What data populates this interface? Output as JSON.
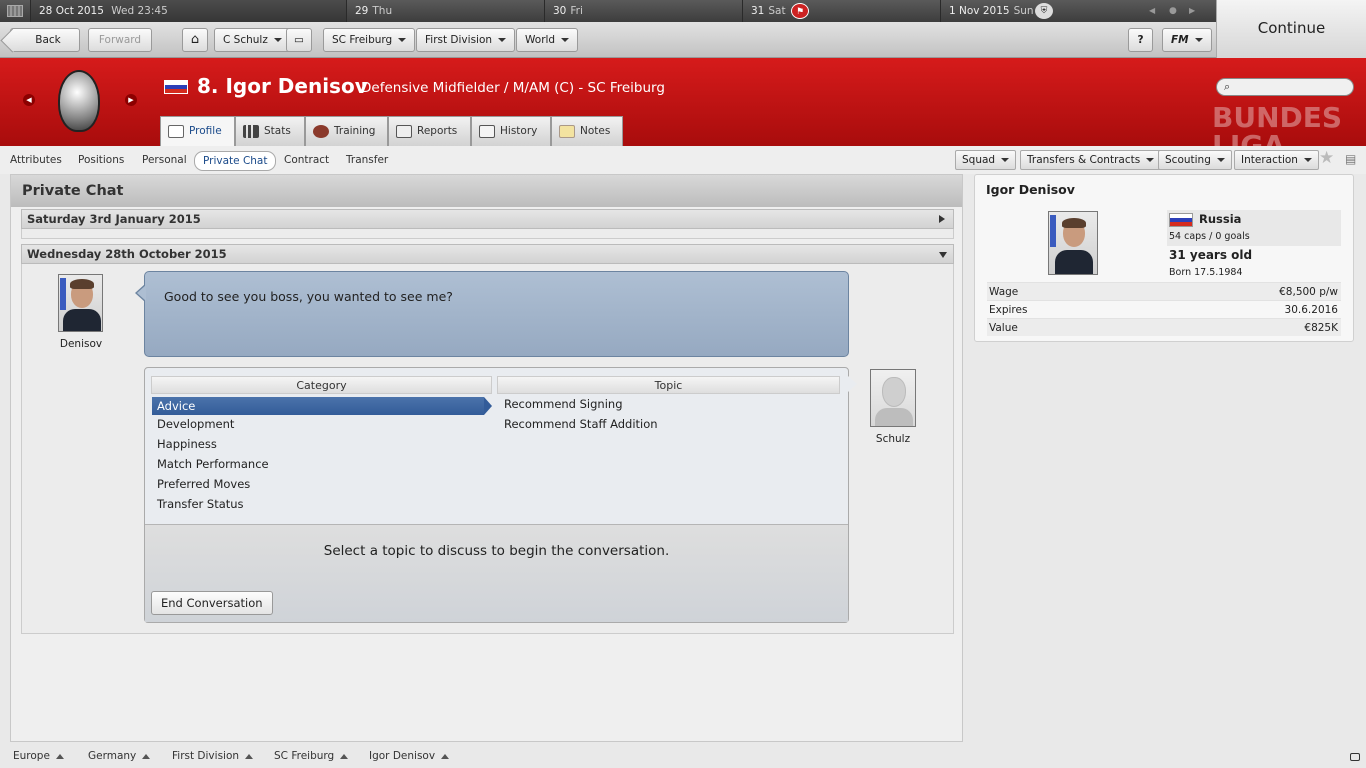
{
  "calendar": {
    "today_date": "28 Oct 2015",
    "today_day": "Wed 23:45",
    "days": [
      {
        "num": "29",
        "wd": "Thu"
      },
      {
        "num": "30",
        "wd": "Fri"
      },
      {
        "num": "31",
        "wd": "Sat"
      },
      {
        "num": "1 Nov 2015",
        "wd": "Sun"
      }
    ]
  },
  "toolbar": {
    "back_label": "Back",
    "forward_label": "Forward",
    "manager_label": "C Schulz",
    "club_label": "SC Freiburg",
    "division_label": "First Division",
    "world_label": "World",
    "help_label": "?",
    "fm_label": "FM"
  },
  "continue_label": "Continue",
  "player": {
    "title": "8. Igor Denisov",
    "subtitle": "Defensive Midfielder / M/AM (C) - SC Freiburg"
  },
  "tabs": [
    {
      "label": "Profile",
      "icon": "profile-icon"
    },
    {
      "label": "Stats",
      "icon": "stats-icon"
    },
    {
      "label": "Training",
      "icon": "training-icon"
    },
    {
      "label": "Reports",
      "icon": "reports-icon"
    },
    {
      "label": "History",
      "icon": "history-icon"
    },
    {
      "label": "Notes",
      "icon": "notes-icon"
    }
  ],
  "league_logo_text": "BUNDES LIGA",
  "subnav": [
    "Attributes",
    "Positions",
    "Personal",
    "Private Chat",
    "Contract",
    "Transfer"
  ],
  "actions": [
    "Squad",
    "Transfers & Contracts",
    "Scouting",
    "Interaction"
  ],
  "panel": {
    "title": "Private Chat",
    "section1": "Saturday 3rd January 2015",
    "section2": "Wednesday 28th October 2015",
    "player_caption": "Denisov",
    "manager_caption": "Schulz",
    "speech": "Good to see you boss, you wanted to see me?",
    "category_header": "Category",
    "topic_header": "Topic",
    "categories": [
      "Advice",
      "Development",
      "Happiness",
      "Match Performance",
      "Preferred Moves",
      "Transfer Status"
    ],
    "topics": [
      "Recommend Signing",
      "Recommend Staff Addition"
    ],
    "prompt": "Select a topic to discuss to begin the conversation.",
    "end_label": "End Conversation"
  },
  "card": {
    "name": "Igor Denisov",
    "nation": "Russia",
    "caps": "54 caps / 0 goals",
    "age": "31 years old",
    "born": "Born 17.5.1984",
    "rows": [
      {
        "label": "Wage",
        "value": "€8,500 p/w"
      },
      {
        "label": "Expires",
        "value": "30.6.2016"
      },
      {
        "label": "Value",
        "value": "€825K"
      }
    ]
  },
  "breadcrumbs": [
    "Europe",
    "Germany",
    "First Division",
    "SC Freiburg",
    "Igor Denisov"
  ],
  "colors": {
    "header_red": "#c41414",
    "selection_blue": "#3a62a0",
    "speech_blue": "#a2b4ca"
  }
}
